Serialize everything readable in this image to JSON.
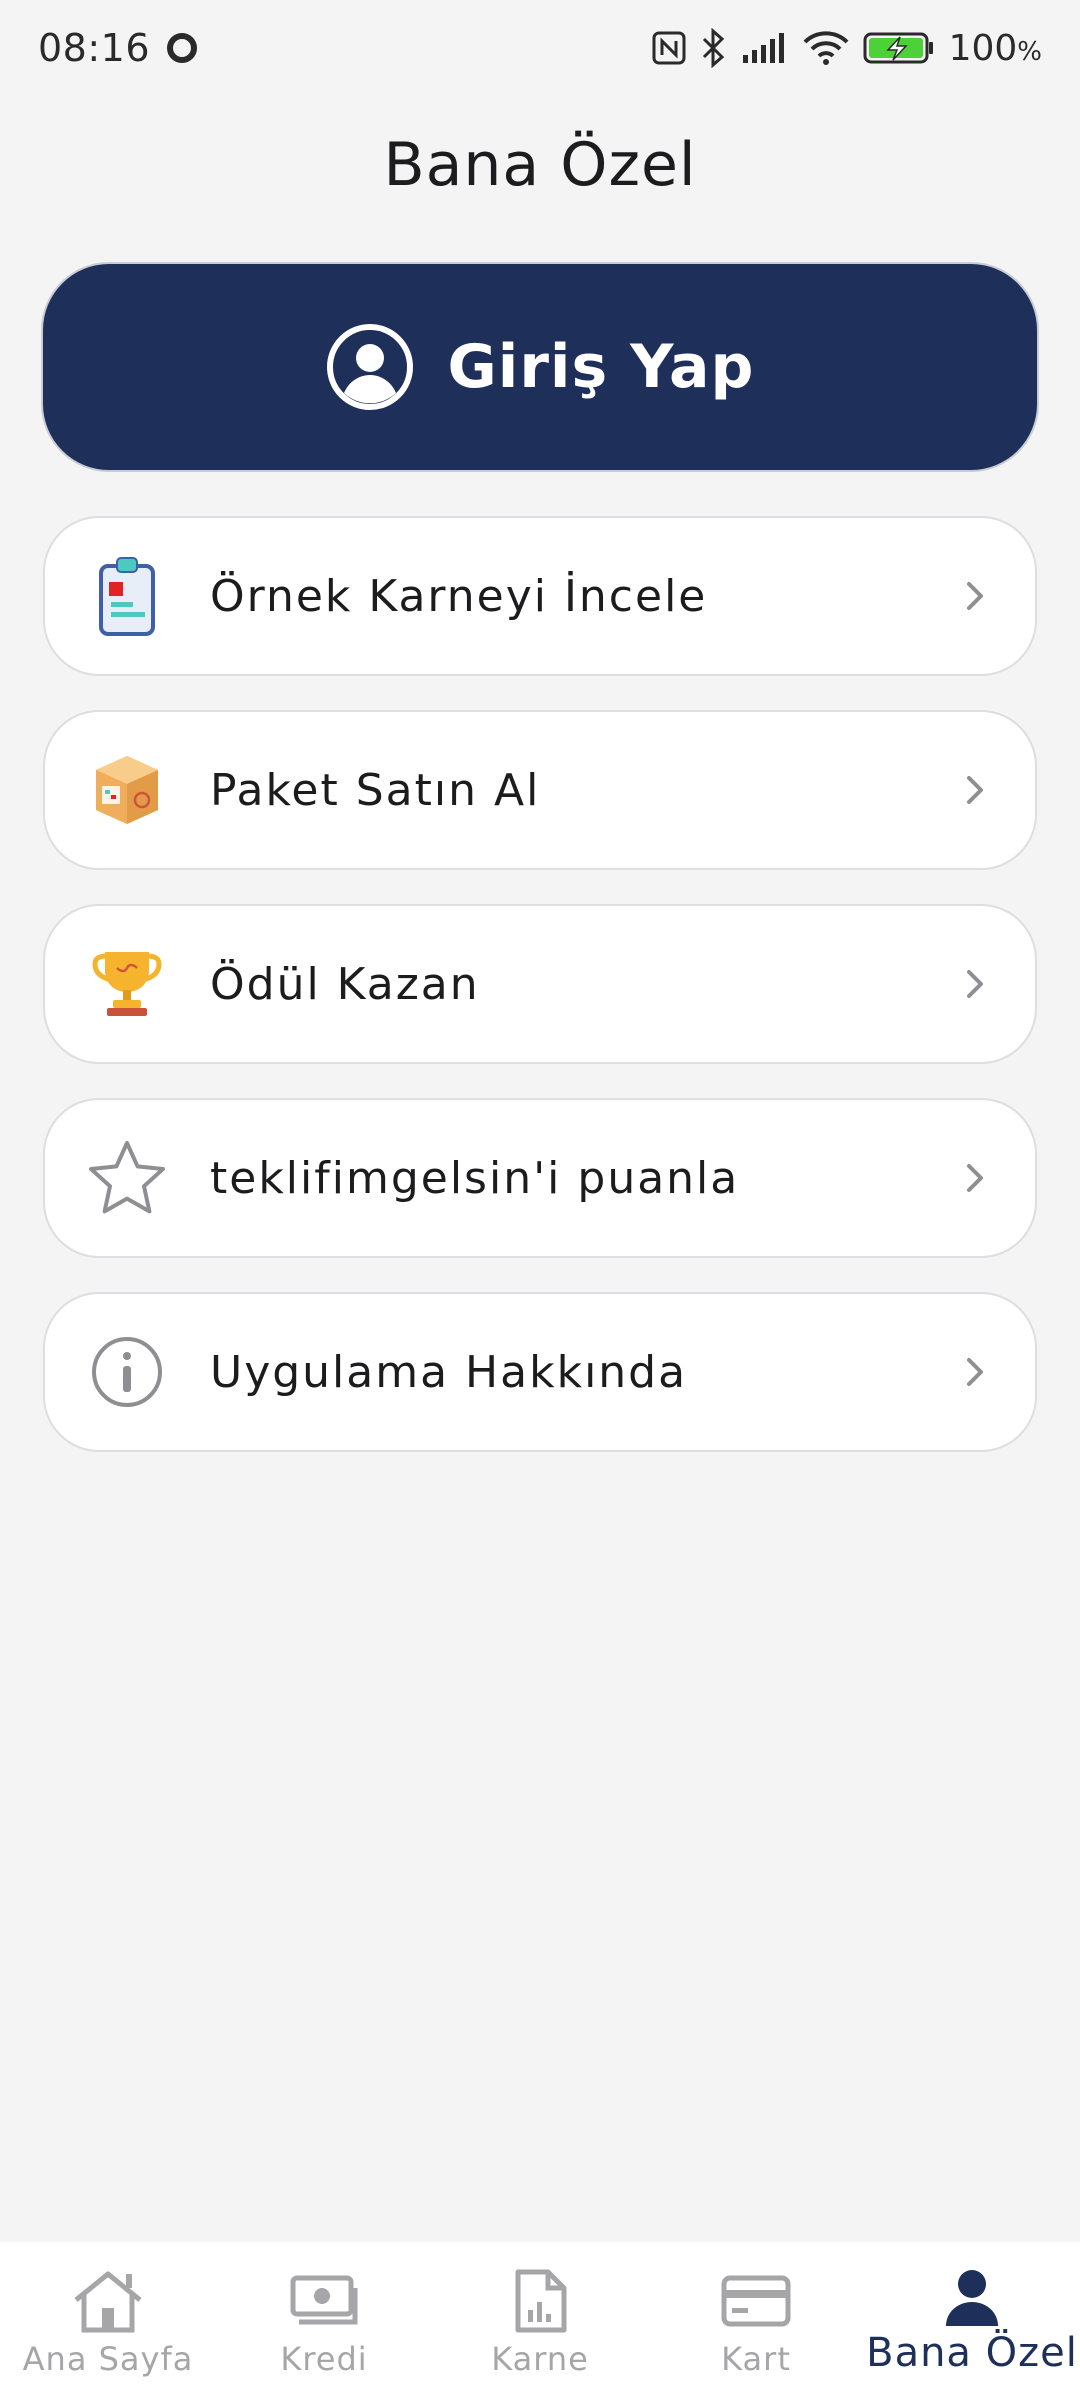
{
  "status_bar": {
    "time": "08:16",
    "battery_percent": "100",
    "battery_unit": "%"
  },
  "header": {
    "title": "Bana Özel"
  },
  "login": {
    "label": "Giriş Yap",
    "icon": "user-circle-icon"
  },
  "menu": {
    "items": [
      {
        "label": "Örnek Karneyi İncele",
        "icon": "clipboard-report-icon"
      },
      {
        "label": "Paket Satın Al",
        "icon": "package-box-icon"
      },
      {
        "label": "Ödül Kazan",
        "icon": "trophy-icon"
      },
      {
        "label": "teklifimgelsin'i puanla",
        "icon": "star-icon"
      },
      {
        "label": "Uygulama Hakkında",
        "icon": "info-icon"
      }
    ]
  },
  "bottom_nav": {
    "items": [
      {
        "label": "Ana Sayfa",
        "icon": "home-icon",
        "active": false
      },
      {
        "label": "Kredi",
        "icon": "money-icon",
        "active": false
      },
      {
        "label": "Karne",
        "icon": "report-document-icon",
        "active": false
      },
      {
        "label": "Kart",
        "icon": "credit-card-icon",
        "active": false
      },
      {
        "label": "Bana Özel",
        "icon": "user-icon",
        "active": true
      }
    ]
  },
  "colors": {
    "primary": "#1e2f59",
    "background": "#f4f4f5",
    "inactive_nav": "#a6a6a8",
    "battery_green": "#4cd137"
  }
}
